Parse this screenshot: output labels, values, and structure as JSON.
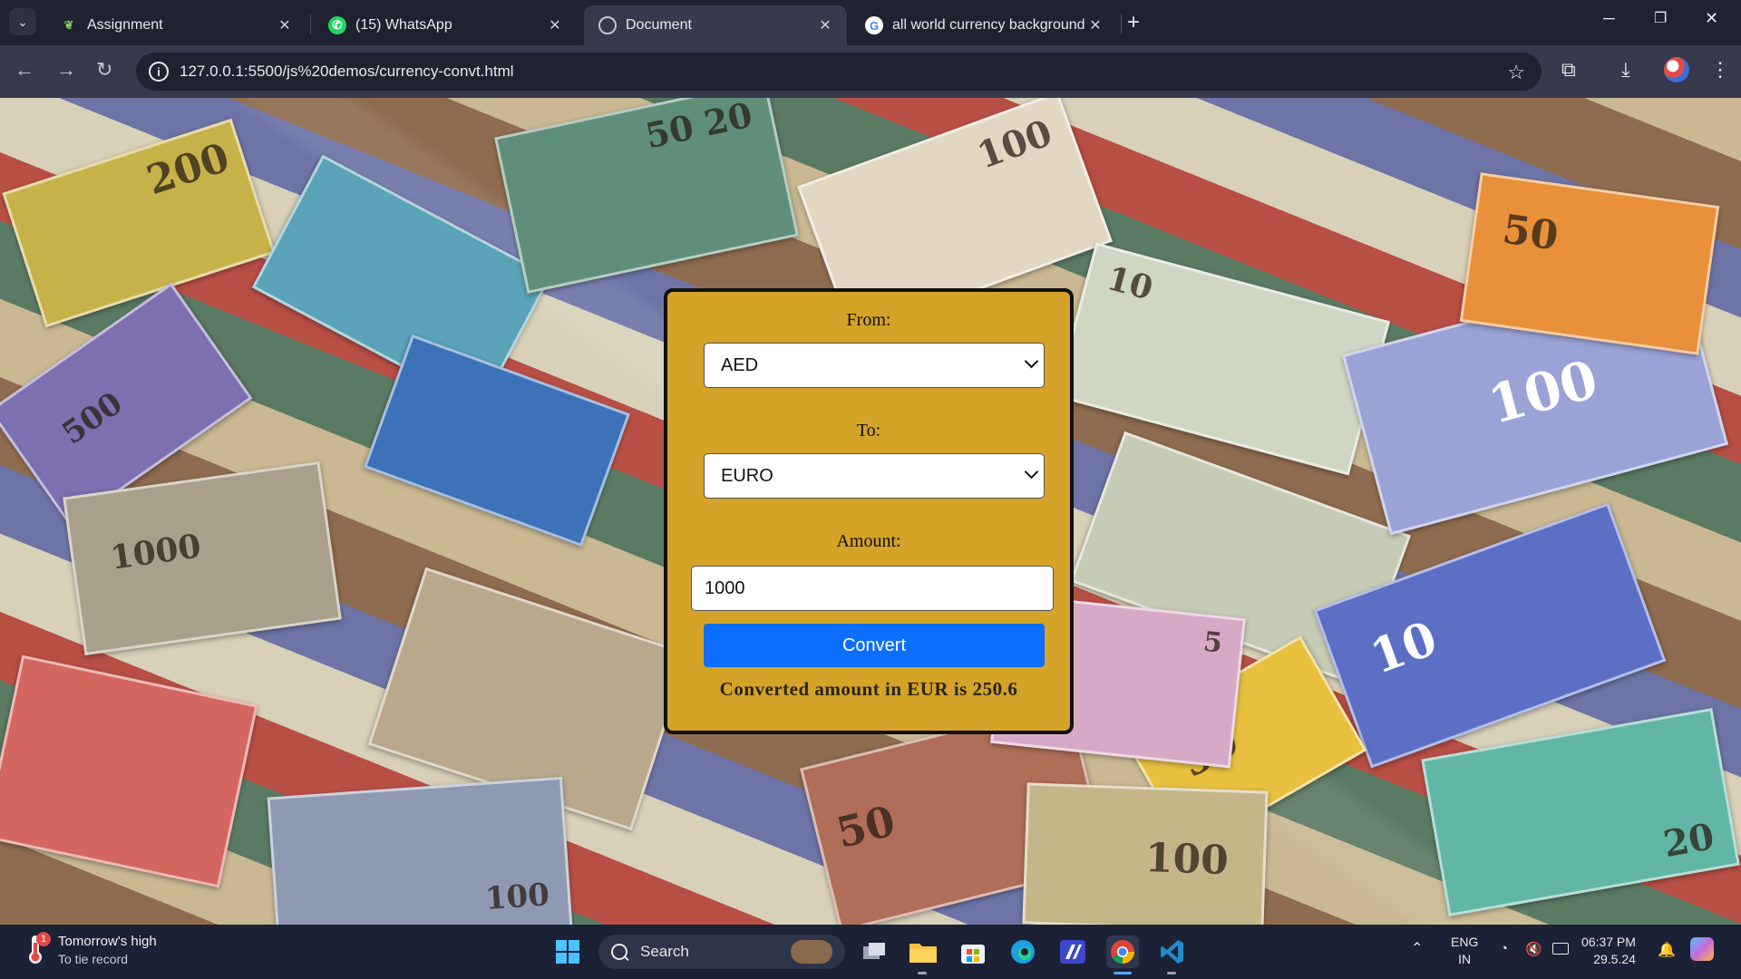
{
  "browser": {
    "tabs": [
      {
        "title": "Assignment",
        "icon": "bird-favicon",
        "active": false
      },
      {
        "title": "(15) WhatsApp",
        "icon": "whatsapp-favicon",
        "active": false
      },
      {
        "title": "Document",
        "icon": "globe-favicon",
        "active": true
      },
      {
        "title": "all world currency background i",
        "icon": "google-favicon",
        "active": false
      }
    ],
    "url": "127.0.0.1:5500/js%20demos/currency-convt.html"
  },
  "converter": {
    "from_label": "From:",
    "from_value": "AED",
    "to_label": "To:",
    "to_value": "EURO",
    "amount_label": "Amount:",
    "amount_value": "1000",
    "convert_label": "Convert",
    "result_text": "Converted amount in EUR is 250.6",
    "card_color": "#d4a327",
    "button_color": "#0d6efd"
  },
  "taskbar": {
    "weather_line1": "Tomorrow's high",
    "weather_line2": "To tie record",
    "weather_badge": "1",
    "search_label": "Search",
    "language_line1": "ENG",
    "language_line2": "IN",
    "time": "06:37 PM",
    "date": "29.5.24"
  }
}
